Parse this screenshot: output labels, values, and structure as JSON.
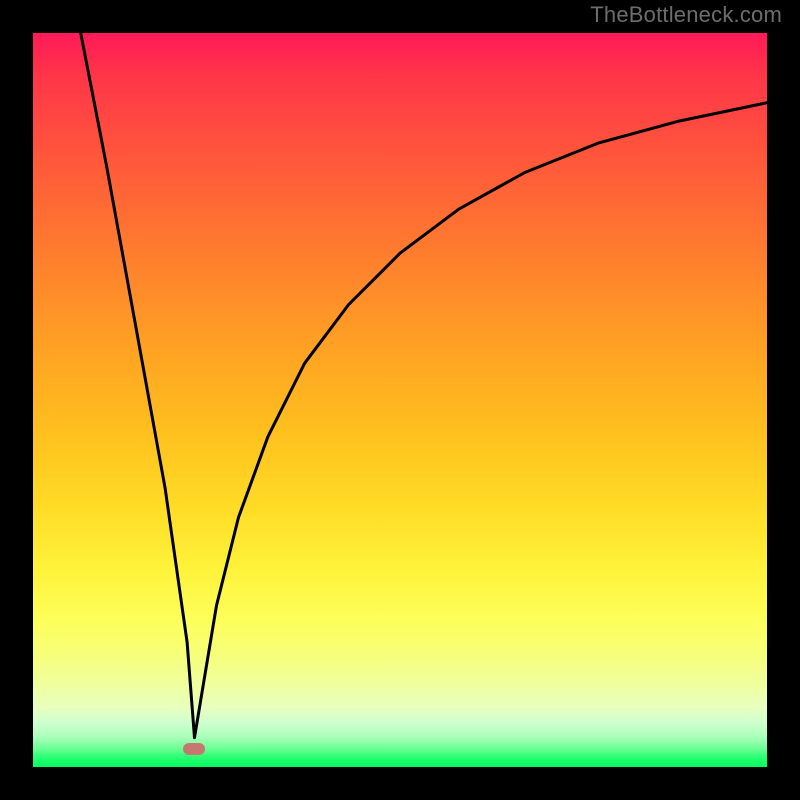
{
  "watermark": "TheBottleneck.com",
  "colors": {
    "frame": "#000000",
    "curve": "#000000",
    "marker": "#c6776f"
  },
  "chart_data": {
    "type": "line",
    "title": "",
    "xlabel": "",
    "ylabel": "",
    "xlim": [
      0,
      100
    ],
    "ylim": [
      0,
      100
    ],
    "note": "x,y are percentages of plot area from left/top. The curve descends steeply from top-left to a minimum near x≈22, then rises with decreasing slope toward the upper right (saturating curve).",
    "series": [
      {
        "name": "curve",
        "x": [
          6.5,
          10,
          14,
          18,
          21,
          22,
          23,
          25,
          28,
          32,
          37,
          43,
          50,
          58,
          67,
          77,
          88,
          100
        ],
        "y": [
          0,
          18,
          40,
          62,
          83,
          96,
          90,
          78,
          66,
          55,
          45,
          37,
          30,
          24,
          19,
          15,
          12,
          9.5
        ]
      }
    ],
    "marker": {
      "x_pct": 22,
      "y_pct": 97.6
    },
    "gradient_stops": [
      {
        "pct": 0,
        "color": "#ff1a58"
      },
      {
        "pct": 6,
        "color": "#ff3648"
      },
      {
        "pct": 18,
        "color": "#ff5a3a"
      },
      {
        "pct": 30,
        "color": "#ff7d2e"
      },
      {
        "pct": 42,
        "color": "#ff9f24"
      },
      {
        "pct": 54,
        "color": "#ffbf1e"
      },
      {
        "pct": 64,
        "color": "#ffda25"
      },
      {
        "pct": 73,
        "color": "#fff23a"
      },
      {
        "pct": 80,
        "color": "#fdff5a"
      },
      {
        "pct": 85,
        "color": "#f6ff7c"
      },
      {
        "pct": 89,
        "color": "#efffa0"
      },
      {
        "pct": 92,
        "color": "#e7ffc0"
      },
      {
        "pct": 94,
        "color": "#ceffcf"
      },
      {
        "pct": 96,
        "color": "#a6ffb8"
      },
      {
        "pct": 97.5,
        "color": "#6cff94"
      },
      {
        "pct": 98.6,
        "color": "#2dff74"
      },
      {
        "pct": 100,
        "color": "#00ff5e"
      }
    ]
  }
}
